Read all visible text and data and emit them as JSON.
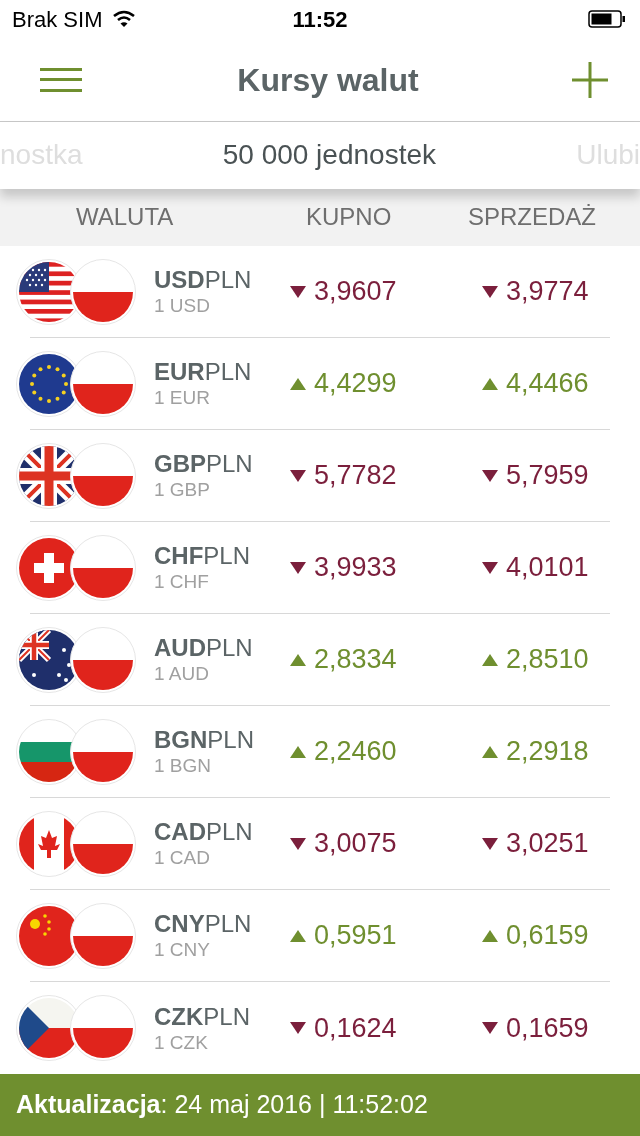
{
  "status_bar": {
    "carrier": "Brak SIM",
    "time": "11:52"
  },
  "nav": {
    "title": "Kursy walut"
  },
  "tabs": [
    {
      "label": "nostka",
      "selected": false
    },
    {
      "label": "50 000 jednostek",
      "selected": true
    },
    {
      "label": "Ulubi",
      "selected": false
    }
  ],
  "table": {
    "columns": [
      "WALUTA",
      "KUPNO",
      "SPRZEDAŻ"
    ],
    "rows": [
      {
        "base": "USD",
        "quote": "PLN",
        "unit": "1 USD",
        "buy": "3,9607",
        "buy_rising": false,
        "sell": "3,9774",
        "sell_rising": false
      },
      {
        "base": "EUR",
        "quote": "PLN",
        "unit": "1 EUR",
        "buy": "4,4299",
        "buy_rising": true,
        "sell": "4,4466",
        "sell_rising": true
      },
      {
        "base": "GBP",
        "quote": "PLN",
        "unit": "1 GBP",
        "buy": "5,7782",
        "buy_rising": false,
        "sell": "5,7959",
        "sell_rising": false
      },
      {
        "base": "CHF",
        "quote": "PLN",
        "unit": "1 CHF",
        "buy": "3,9933",
        "buy_rising": false,
        "sell": "4,0101",
        "sell_rising": false
      },
      {
        "base": "AUD",
        "quote": "PLN",
        "unit": "1 AUD",
        "buy": "2,8334",
        "buy_rising": true,
        "sell": "2,8510",
        "sell_rising": true
      },
      {
        "base": "BGN",
        "quote": "PLN",
        "unit": "1 BGN",
        "buy": "2,2460",
        "buy_rising": true,
        "sell": "2,2918",
        "sell_rising": true
      },
      {
        "base": "CAD",
        "quote": "PLN",
        "unit": "1 CAD",
        "buy": "3,0075",
        "buy_rising": false,
        "sell": "3,0251",
        "sell_rising": false
      },
      {
        "base": "CNY",
        "quote": "PLN",
        "unit": "1 CNY",
        "buy": "0,5951",
        "buy_rising": true,
        "sell": "0,6159",
        "sell_rising": true
      },
      {
        "base": "CZK",
        "quote": "PLN",
        "unit": "1 CZK",
        "buy": "0,1624",
        "buy_rising": false,
        "sell": "0,1659",
        "sell_rising": false
      }
    ]
  },
  "footer": {
    "text": "**Aktualizacja**: 24 maj 2016 | 11:52:02"
  }
}
